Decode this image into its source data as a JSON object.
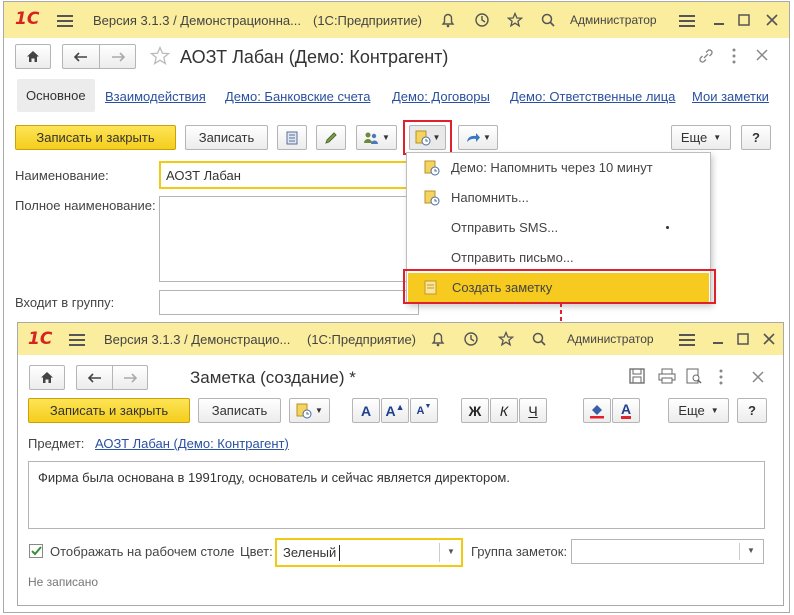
{
  "main_window": {
    "logo": "1С",
    "title": "Версия 3.1.3 / Демонстрационна...",
    "platform": "(1С:Предприятие)",
    "user": "Администратор",
    "form_title": "АОЗТ Лабан (Демо: Контрагент)",
    "tabs": [
      {
        "label": "Основное",
        "active": true
      },
      {
        "label": "Взаимодействия"
      },
      {
        "label": "Демо: Банковские счета"
      },
      {
        "label": "Демо: Договоры"
      },
      {
        "label": "Демо: Ответственные лица"
      },
      {
        "label": "Мои заметки"
      }
    ],
    "toolbar": {
      "save_close": "Записать и закрыть",
      "save": "Записать",
      "more": "Еще",
      "help": "?"
    },
    "fields": {
      "name_label": "Наименование:",
      "name_value": "АОЗТ Лабан",
      "full_name_label": "Полное наименование:",
      "group_label": "Входит в группу:"
    }
  },
  "dropdown_menu": {
    "items": [
      {
        "label": "Демо: Напомнить через 10 минут",
        "icon": "note-clock-icon"
      },
      {
        "label": "Напомнить...",
        "icon": "note-clock-icon"
      },
      {
        "label": "Отправить SMS..."
      },
      {
        "label": "Отправить письмо..."
      },
      {
        "label": "Создать заметку",
        "icon": "note-icon",
        "highlighted": true
      }
    ]
  },
  "note_window": {
    "logo": "1С",
    "title": "Версия 3.1.3 / Демонстрацио...",
    "platform": "(1С:Предприятие)",
    "user": "Администратор",
    "form_title": "Заметка (создание) *",
    "toolbar": {
      "save_close": "Записать и закрыть",
      "save": "Записать",
      "bold": "Ж",
      "italic": "К",
      "underline": "Ч",
      "more": "Еще",
      "help": "?"
    },
    "subject_label": "Предмет:",
    "subject_link": "АОЗТ Лабан (Демо: Контрагент)",
    "note_text": "Фирма была основана в 1991году, основатель и сейчас является директором.",
    "show_on_desktop_label": "Отображать на рабочем столе",
    "show_on_desktop_checked": true,
    "color_label": "Цвет:",
    "color_value": "Зеленый",
    "group_label": "Группа заметок:",
    "group_value": "",
    "status": "Не записано"
  },
  "colors": {
    "titlebar": "#fbed9e",
    "accent_yellow": "#f5ce1c",
    "link": "#2a50a0",
    "highlight_red": "#e0202b",
    "logo_red": "#d6231e"
  }
}
